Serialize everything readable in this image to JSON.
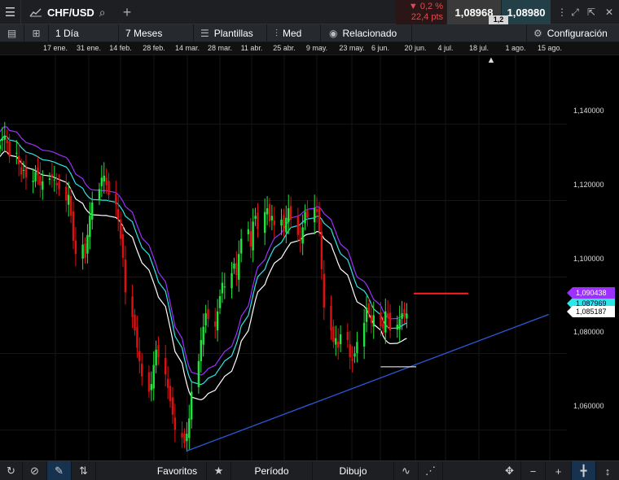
{
  "header": {
    "symbol": "CHF/USD",
    "change_pct": "▼ 0,2 %",
    "change_pts": "22,4 pts",
    "bid": "1,08968",
    "ask": "1,08980",
    "spread": "1,2"
  },
  "toolbar": {
    "interval": "1 Día",
    "range": "7 Meses",
    "templates": "Plantillas",
    "chart_type": "Med",
    "related": "Relacionado",
    "settings": "Configuración"
  },
  "date_axis": [
    "17 ene.",
    "31 ene.",
    "14 feb.",
    "28 feb.",
    "14 mar.",
    "28 mar.",
    "11 abr.",
    "25 abr.",
    "9 may.",
    "23 may.",
    "6 jun.",
    "20 jun.",
    "4 jul.",
    "18 jul.",
    "1 ago.",
    "15 ago."
  ],
  "price_axis": [
    "1,140000",
    "1,120000",
    "1,100000",
    "1,080000",
    "1,060000"
  ],
  "price_tags": {
    "current": "1,090438",
    "ma_upper": "1,087969",
    "ma_lower": "1,085187"
  },
  "bottom": {
    "favorites": "Favoritos",
    "period": "Período",
    "drawing": "Dibujo"
  },
  "colors": {
    "up": "#1ee63c",
    "down": "#e01010",
    "ma_purple": "#9b30ff",
    "ma_cyan": "#2ee6e6",
    "ma_white": "#ffffff",
    "trendline": "#2a5ad8"
  },
  "chart_data": {
    "type": "candlestick",
    "symbol": "CHF/USD",
    "interval": "1 Día",
    "ylim": [
      1.052,
      1.158
    ],
    "x_start": "2016-01-04",
    "x_end": "2016-08-19",
    "trendline": {
      "from": [
        "2016-03-23",
        1.0545
      ],
      "to": [
        "2016-08-23",
        1.0902
      ]
    },
    "resistance": {
      "at": 1.0957,
      "from": "2016-06-27",
      "to": "2016-07-20"
    },
    "support_mark": {
      "at": 1.0765,
      "from": "2016-06-13",
      "to": "2016-06-28"
    },
    "closes": [
      1.1345,
      1.1362,
      1.137,
      1.135,
      1.1315,
      1.1325,
      1.1295,
      1.1268,
      1.128,
      1.126,
      1.1252,
      1.1275,
      1.1266,
      1.124,
      1.125,
      1.1258,
      1.1262,
      1.1255,
      1.124,
      1.123,
      1.12,
      1.1215,
      1.116,
      1.1095,
      1.106,
      1.1085,
      1.105,
      1.111,
      1.116,
      1.1195,
      1.123,
      1.126,
      1.1265,
      1.124,
      1.1215,
      1.119,
      1.115,
      1.11,
      1.105,
      1.096,
      1.0895,
      1.086,
      1.0815,
      1.078,
      1.074,
      1.07,
      1.072,
      1.077,
      1.081,
      1.079,
      1.0745,
      1.071,
      1.0675,
      1.064,
      1.06,
      1.058,
      1.0565,
      1.059,
      1.063,
      1.07,
      1.078,
      1.0835,
      1.087,
      1.0905,
      1.089,
      1.087,
      1.091,
      1.095,
      1.0985,
      1.0975,
      1.101,
      1.1035,
      1.1005,
      1.106,
      1.11,
      1.1125,
      1.108,
      1.1145,
      1.116,
      1.1125,
      1.117,
      1.118,
      1.1145,
      1.116,
      1.1135,
      1.115,
      1.112,
      1.1155,
      1.118,
      1.115,
      1.111,
      1.1095,
      1.113,
      1.117,
      1.1155,
      1.118,
      1.117,
      1.112,
      1.102,
      1.092,
      1.086,
      1.083,
      1.084,
      1.0815,
      1.085,
      1.0835,
      1.079,
      1.078,
      1.08,
      1.083,
      1.088,
      1.092,
      1.0905,
      1.088,
      1.09,
      1.087,
      1.0865,
      1.091,
      1.0895,
      1.086,
      1.0875,
      1.089,
      1.0905,
      1.0895,
      1.0904
    ]
  }
}
